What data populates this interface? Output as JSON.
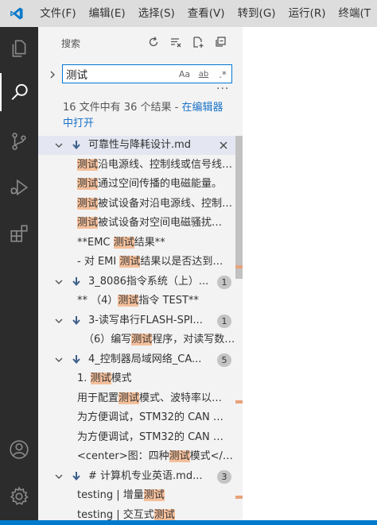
{
  "menubar": {
    "items": [
      "文件(F)",
      "编辑(E)",
      "选择(S)",
      "查看(V)",
      "转到(G)",
      "运行(R)",
      "终端(T"
    ]
  },
  "activity_bar": {
    "icons": [
      "files-icon",
      "search-icon",
      "source-control-icon",
      "run-debug-icon",
      "extensions-icon",
      "account-icon",
      "settings-gear-icon"
    ]
  },
  "sidebar": {
    "title": "搜索",
    "search": {
      "value": "测试",
      "match_case": "Aa",
      "whole_word": "ab",
      "regex": ".*"
    },
    "more": "···",
    "summary_prefix": "16 文件中有 36 个结果 - ",
    "summary_link": "在编辑器中打开"
  },
  "results": [
    {
      "kind": "file",
      "name": "可靠性与降耗设计.md",
      "selected": true,
      "badge": null
    },
    {
      "kind": "match",
      "pre": "",
      "hit": "测试",
      "post": "沿电源线、控制线或信号线…"
    },
    {
      "kind": "match",
      "pre": "",
      "hit": "测试",
      "post": "通过空间传播的电磁能量。"
    },
    {
      "kind": "match",
      "pre": "",
      "hit": "测试",
      "post": "被试设备对沿电源线、控制线…"
    },
    {
      "kind": "match",
      "pre": "",
      "hit": "测试",
      "post": "被试设备对空间电磁骚扰…"
    },
    {
      "kind": "match",
      "pre": "**EMC ",
      "hit": "测试",
      "post": "结果**"
    },
    {
      "kind": "match",
      "pre": "- 对 EMI ",
      "hit": "测试",
      "post": "结果以是否达到…"
    },
    {
      "kind": "file",
      "name": "3_8086指令系统（上）...",
      "selected": false,
      "badge": "1"
    },
    {
      "kind": "match",
      "pre": "** （4）",
      "hit": "测试",
      "post": "指令 TEST**"
    },
    {
      "kind": "file",
      "name": "3-读写串行FLASH-SPI...",
      "selected": false,
      "badge": "1"
    },
    {
      "kind": "match",
      "deep": true,
      "pre": "（6）编写",
      "hit": "测试",
      "post": "程序，对读写数…"
    },
    {
      "kind": "file",
      "name": "4_控制器局域网络_CA...",
      "selected": false,
      "badge": "5"
    },
    {
      "kind": "match",
      "pre": "1. ",
      "hit": "测试",
      "post": "模式"
    },
    {
      "kind": "match",
      "pre": "用于配置",
      "hit": "测试",
      "post": "模式、波特率以…"
    },
    {
      "kind": "match",
      "pre": "为方便调试，STM32的 CAN …",
      "hit": "",
      "post": ""
    },
    {
      "kind": "match",
      "pre": "为方便调试，STM32的 CAN …",
      "hit": "",
      "post": ""
    },
    {
      "kind": "match",
      "pre": "<center>图：四种",
      "hit": "测试",
      "post": "模式</…"
    },
    {
      "kind": "file",
      "name": "# 计算机专业英语.md...",
      "selected": false,
      "badge": "3"
    },
    {
      "kind": "match",
      "pre": "testing             | 增量",
      "hit": "测试",
      "post": ""
    },
    {
      "kind": "match",
      "pre": "testing             | 交互式",
      "hit": "测试",
      "post": ""
    }
  ]
}
